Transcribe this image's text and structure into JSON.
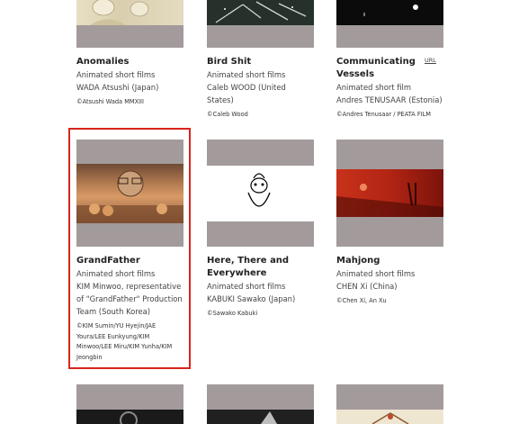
{
  "cards": [
    {
      "title": "Anomalies",
      "category": "Animated short films",
      "creator": "WADA Atsushi (Japan)",
      "credit": "©Atsushi Wada MMXIII"
    },
    {
      "title": "Bird Shit",
      "category": "Animated short films",
      "creator": "Caleb WOOD (United States)",
      "credit": "©Caleb Wood"
    },
    {
      "title": "Communicating Vessels",
      "category": "Animated short film",
      "creator": "Andres TENUSAAR (Estonia)",
      "credit": "©Andres Tenusaar / PEATA FILM",
      "link": "URL"
    },
    {
      "title": "GrandFather",
      "category": "Animated short films",
      "creator": "KIM Minwoo, representative of \"GrandFather\" Production Team (South Korea)",
      "credit": "©KIM Sumin/YU Hyejin/JAE Youra/LEE Eunkyung/KIM Minwoo/LEE Miru/KIM Yunha/KIM Jeongbin"
    },
    {
      "title": "Here, There and Everywhere",
      "category": "Animated short films",
      "creator": "KABUKI Sawako (Japan)",
      "credit": "©Sawako Kabuki"
    },
    {
      "title": "Mahjong",
      "category": "Animated short films",
      "creator": "CHEN Xi (China)",
      "credit": "©Chen Xi, An Xu"
    }
  ],
  "colors": {
    "selection_border": "#d9251d",
    "thumb_frame": "#a39b9b"
  }
}
